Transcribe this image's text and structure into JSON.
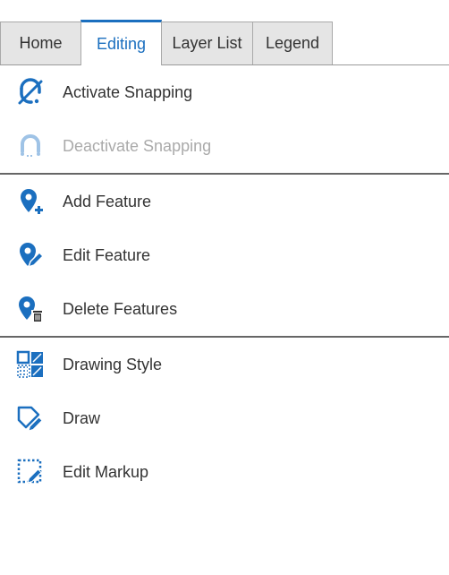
{
  "tabs": [
    {
      "label": "Home"
    },
    {
      "label": "Editing"
    },
    {
      "label": "Layer List"
    },
    {
      "label": "Legend"
    }
  ],
  "active_tab": "Editing",
  "colors": {
    "accent": "#1b6fbf",
    "disabled": "#aaaaaa",
    "text": "#333333"
  },
  "groups": {
    "snapping": {
      "activate": {
        "label": "Activate Snapping",
        "icon": "snapping-on-icon"
      },
      "deactivate": {
        "label": "Deactivate Snapping",
        "icon": "snapping-off-icon",
        "disabled": true
      }
    },
    "features": {
      "add": {
        "label": "Add Feature",
        "icon": "add-feature-icon"
      },
      "edit": {
        "label": "Edit Feature",
        "icon": "edit-feature-icon"
      },
      "delete": {
        "label": "Delete Features",
        "icon": "delete-features-icon"
      }
    },
    "markup": {
      "style": {
        "label": "Drawing Style",
        "icon": "drawing-style-icon"
      },
      "draw": {
        "label": "Draw",
        "icon": "draw-icon"
      },
      "edit": {
        "label": "Edit Markup",
        "icon": "edit-markup-icon"
      }
    }
  }
}
